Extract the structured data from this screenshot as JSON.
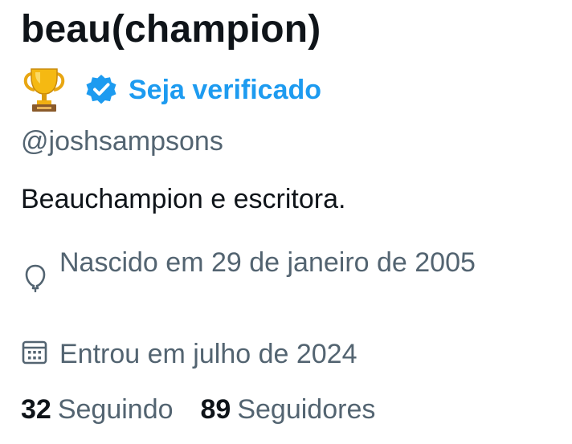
{
  "profile": {
    "display_name": "beau(champion)",
    "trophy_icon": "trophy-icon",
    "verified_icon": "verified-badge-icon",
    "get_verified_label": "Seja verificado",
    "handle": "@joshsampsons",
    "bio": "Beauchampion e escritora.",
    "birth_icon": "balloon-icon",
    "birth_text": "Nascido em 29 de janeiro de 2005",
    "joined_icon": "calendar-icon",
    "joined_text": "Entrou em julho de 2024",
    "following_count": "32",
    "following_label": "Seguindo",
    "followers_count": "89",
    "followers_label": "Seguidores"
  },
  "colors": {
    "accent": "#1d9bf0",
    "text_primary": "#0f1419",
    "text_secondary": "#536471"
  }
}
